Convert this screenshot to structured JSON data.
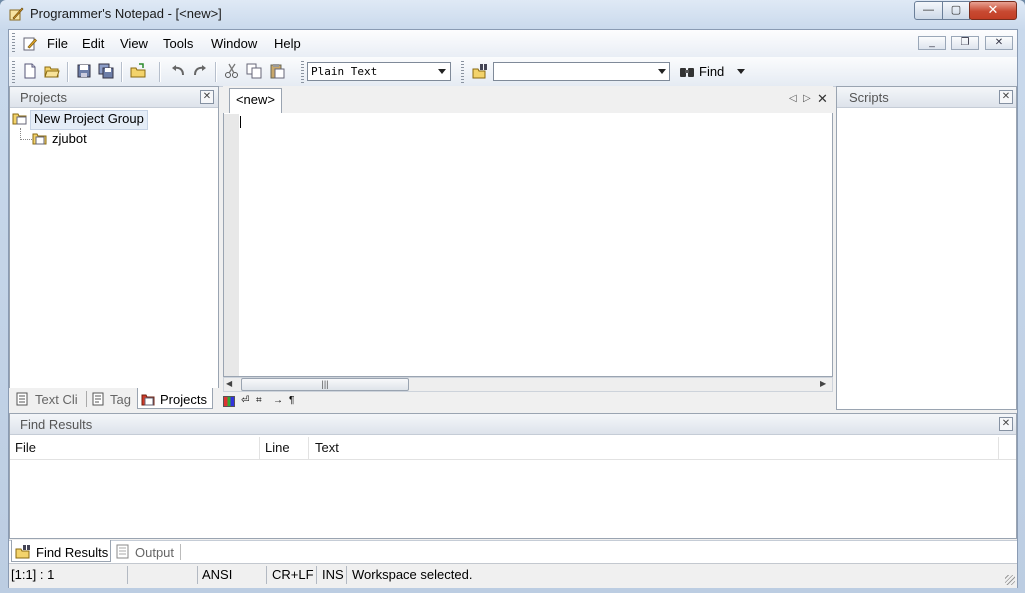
{
  "window": {
    "title": "Programmer's Notepad - [<new>]",
    "minimize_glyph": "—",
    "maximize_glyph": "▢",
    "close_glyph": "✕"
  },
  "menubar": {
    "items": [
      "File",
      "Edit",
      "View",
      "Tools",
      "Window",
      "Help"
    ],
    "mdi_min": "_",
    "mdi_restore": "❐",
    "mdi_close": "✕"
  },
  "toolbar": {
    "scheme": "Plain Text",
    "find_value": "",
    "find_label": "Find"
  },
  "projects_panel": {
    "title": "Projects",
    "tree": {
      "group": "New Project Group",
      "project": "zjubot"
    },
    "tabs": [
      "Text Cli",
      "Tag",
      "Projects"
    ]
  },
  "editor": {
    "tab_label": "<new>",
    "content": ""
  },
  "scripts_panel": {
    "title": "Scripts"
  },
  "find_results": {
    "title": "Find Results",
    "columns": [
      "File",
      "Line",
      "Text"
    ],
    "rows": []
  },
  "output_tabs": [
    "Find Results",
    "Output"
  ],
  "status": {
    "position": "[1:1] : 1",
    "encoding": "ANSI",
    "line_endings": "CR+LF",
    "mode": "INS",
    "message": "Workspace selected."
  }
}
